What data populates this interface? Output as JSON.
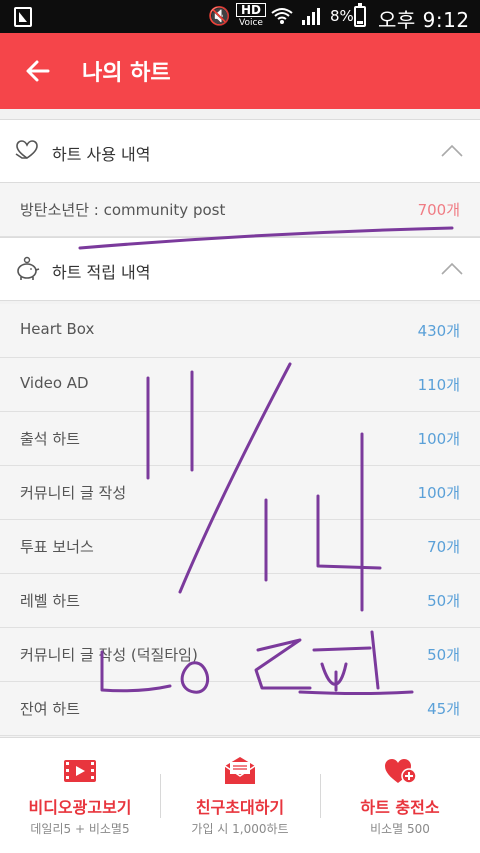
{
  "status_bar": {
    "hd": "HD",
    "voice": "Voice",
    "battery": "8%",
    "time": "오후 9:12"
  },
  "app_bar": {
    "title": "나의 하트"
  },
  "usage_section": {
    "title": "하트 사용 내역",
    "icon": "heart-hands-icon",
    "items": [
      {
        "label": "방탄소년단 : community post",
        "value": "700개"
      }
    ]
  },
  "earn_section": {
    "title": "하트 적립 내역",
    "icon": "piggy-bank-icon",
    "items": [
      {
        "label": "Heart Box",
        "value": "430개"
      },
      {
        "label": "Video AD",
        "value": "110개"
      },
      {
        "label": "출석 하트",
        "value": "100개"
      },
      {
        "label": "커뮤니티 글 작성",
        "value": "100개"
      },
      {
        "label": "투표 보너스",
        "value": "70개"
      },
      {
        "label": "레벨 하트",
        "value": "50개"
      },
      {
        "label": "커뮤니티 글 작성 (덕질타임)",
        "value": "50개"
      },
      {
        "label": "잔여 하트",
        "value": "45개"
      }
    ]
  },
  "bottom_bar": {
    "items": [
      {
        "title": "비디오광고보기",
        "sub": "데일리5 + 비소멸5",
        "icon": "video-icon"
      },
      {
        "title": "친구초대하기",
        "sub": "가입 시 1,000하트",
        "icon": "mail-invite-icon"
      },
      {
        "title": "하트 충전소",
        "sub": "비소멸 500",
        "icon": "heart-plus-icon"
      }
    ]
  },
  "colors": {
    "accent": "#f5454a",
    "value_blue": "#5aa0d8",
    "value_red": "#f07c84",
    "annotation": "#7b3a9c"
  }
}
